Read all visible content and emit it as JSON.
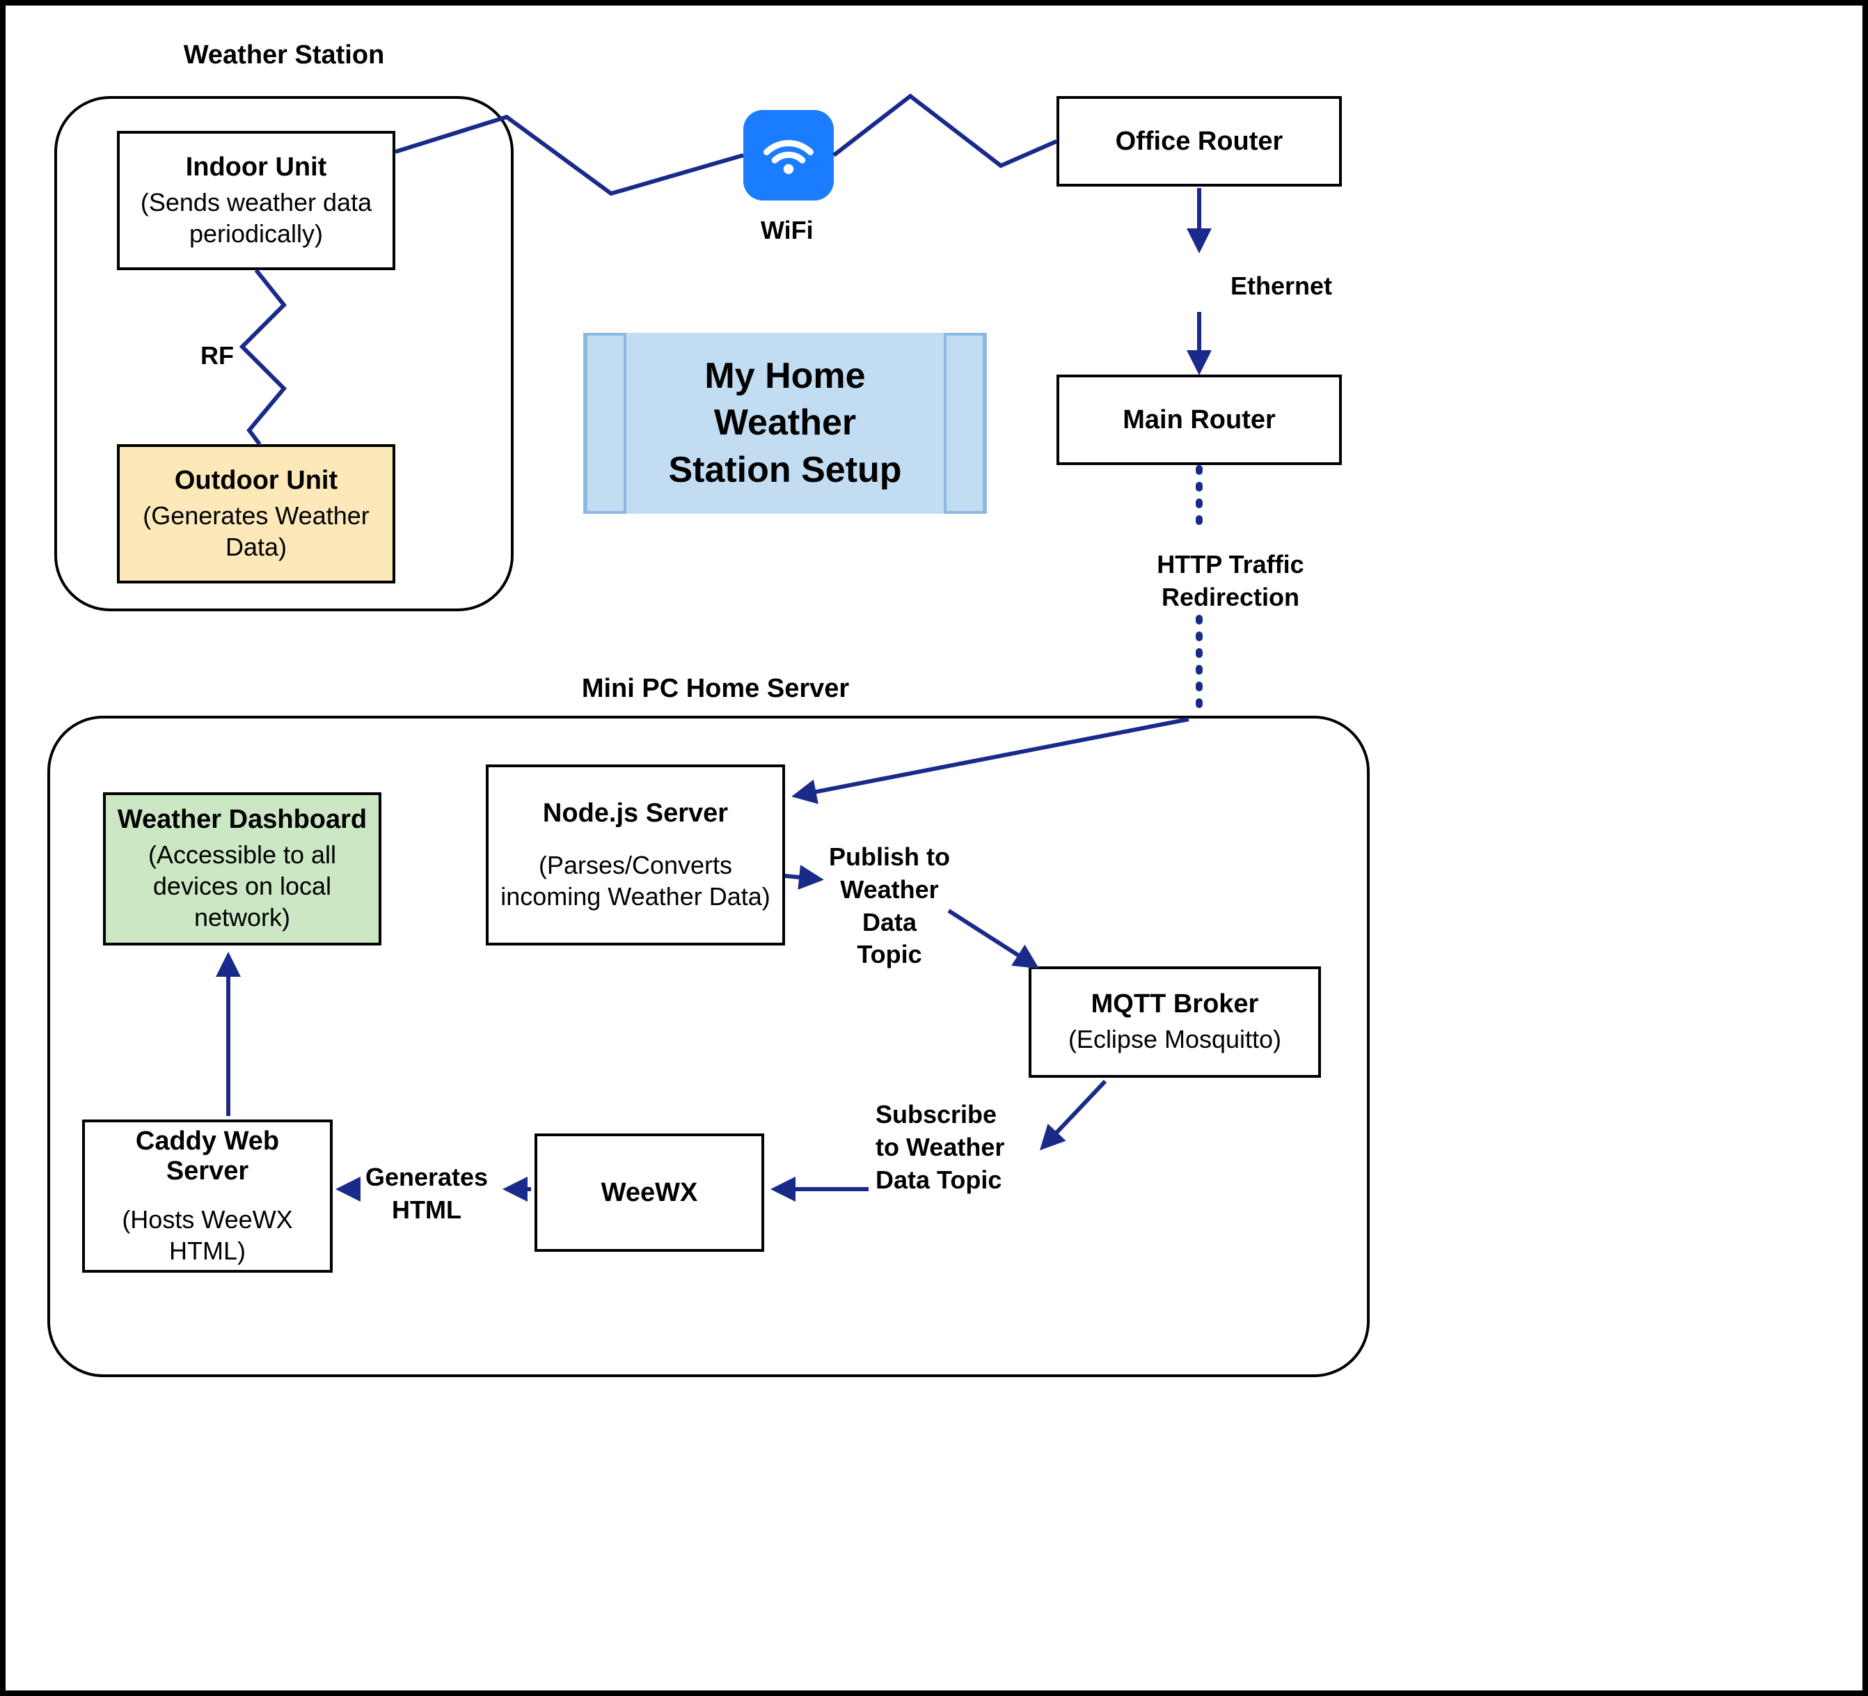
{
  "groups": {
    "weather_station": {
      "title": "Weather Station"
    },
    "home_server": {
      "title": "Mini PC Home Server"
    }
  },
  "title_box": "My Home Weather\nStation Setup",
  "nodes": {
    "indoor_unit": {
      "title": "Indoor Unit",
      "subtitle": "(Sends weather data\nperiodically)"
    },
    "outdoor_unit": {
      "title": "Outdoor Unit",
      "subtitle": "(Generates Weather\nData)"
    },
    "office_router": {
      "title": "Office Router"
    },
    "main_router": {
      "title": "Main Router"
    },
    "nodejs": {
      "title": "Node.js Server",
      "subtitle": "(Parses/Converts\nincoming Weather Data)"
    },
    "mqtt": {
      "title": "MQTT Broker",
      "subtitle": "(Eclipse Mosquitto)"
    },
    "weewx": {
      "title": "WeeWX"
    },
    "caddy": {
      "title": "Caddy Web Server",
      "subtitle": "(Hosts WeeWX\nHTML)"
    },
    "dashboard": {
      "title": "Weather Dashboard",
      "subtitle": "(Accessible to all\ndevices on local\nnetwork)"
    }
  },
  "edges": {
    "wifi": "WiFi",
    "rf": "RF",
    "ethernet": "Ethernet",
    "http_redirect": "HTTP Traffic\nRedirection",
    "publish": "Publish to\nWeather\nData\nTopic",
    "subscribe": "Subscribe\nto Weather\nData Topic",
    "generates_html": "Generates\nHTML"
  },
  "icons": {
    "wifi": "wifi-icon"
  }
}
